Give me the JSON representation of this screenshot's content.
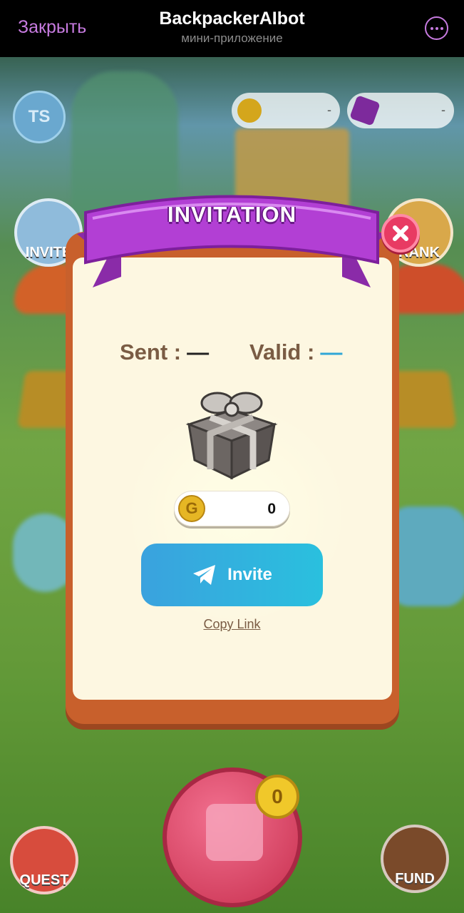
{
  "telegram": {
    "close_label": "Закрыть",
    "title": "BackpackerAIbot",
    "subtitle": "мини-приложение"
  },
  "game_bg": {
    "avatar_initials": "TS",
    "coin_balance": "-",
    "gem_balance": "-",
    "invite_label": "INVITE",
    "rank_label": "RANK",
    "quest_label": "QUEST",
    "fund_label": "FUND",
    "dice_count": "0"
  },
  "modal": {
    "title": "INVITATION",
    "sent_label": "Sent :",
    "sent_value": "—",
    "valid_label": "Valid :",
    "valid_value": "—",
    "reward_coin_letter": "G",
    "reward_value": "0",
    "invite_button": "Invite",
    "copy_link": "Copy Link"
  },
  "colors": {
    "accent_purple": "#c77be0",
    "modal_frame": "#c8602c",
    "modal_bg": "#fdf7e1",
    "ribbon": "#b23fd4",
    "invite_button": "#2ab4de",
    "close_button": "#e83b63"
  }
}
